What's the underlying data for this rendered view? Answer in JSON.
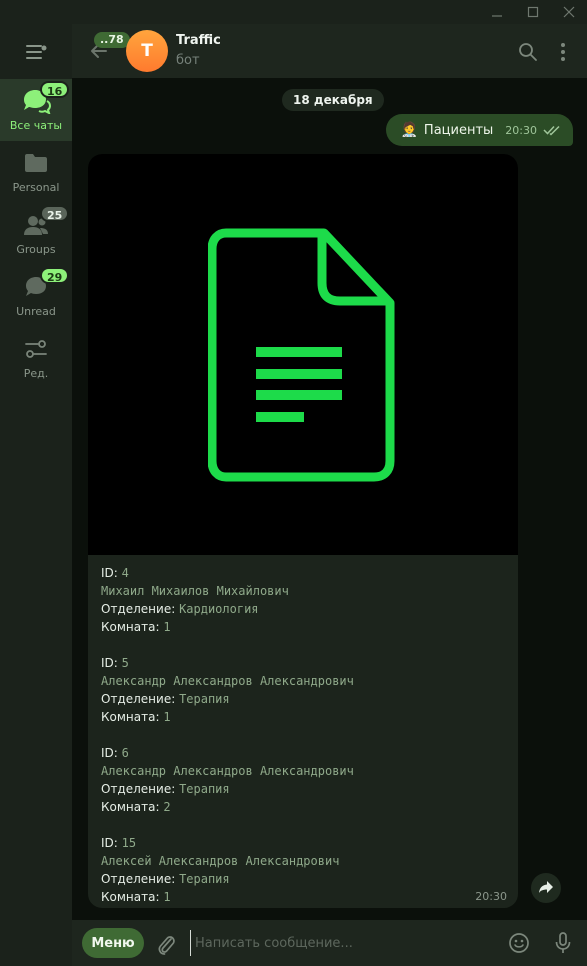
{
  "sidebar": {
    "items": [
      {
        "label": "Все чаты",
        "badge": "16",
        "badge_style": "green",
        "icon": "chats-icon"
      },
      {
        "label": "Personal",
        "badge": null,
        "icon": "folder-icon"
      },
      {
        "label": "Groups",
        "badge": "25",
        "badge_style": "gray",
        "icon": "groups-icon"
      },
      {
        "label": "Unread",
        "badge": "29",
        "badge_style": "green",
        "icon": "unread-chat-icon"
      },
      {
        "label": "Ред.",
        "badge": null,
        "icon": "edit-folders-icon"
      }
    ]
  },
  "header": {
    "unread_count": "..78",
    "avatar_letter": "T",
    "title": "Traffic",
    "subtitle": "бот"
  },
  "chat": {
    "date": "18 декабря",
    "outgoing": {
      "emoji": "🧑‍⚕️",
      "text": "Пациенты",
      "time": "20:30",
      "status": "read"
    },
    "incoming": {
      "time": "20:30",
      "labels": {
        "id": "ID: ",
        "department": "Отделение: ",
        "room": "Комната: "
      },
      "records": [
        {
          "id": "4",
          "name": "Михаил Михаилов Михайлович",
          "department": "Кардиология",
          "room": "1"
        },
        {
          "id": "5",
          "name": "Александр Александров Александрович",
          "department": "Терапия",
          "room": "1"
        },
        {
          "id": "6",
          "name": "Александр Александров Александрович",
          "department": "Терапия",
          "room": "2"
        },
        {
          "id": "15",
          "name": "Алексей Александров Александрович",
          "department": "Терапия",
          "room": "1"
        }
      ]
    }
  },
  "composer": {
    "menu_label": "Меню",
    "placeholder": "Написать сообщение..."
  },
  "colors": {
    "accent": "#8df07a",
    "document_icon": "#1ddb4a",
    "outgoing_bubble": "#2b4c26",
    "incoming_bubble": "#1c241c",
    "background": "#0b100b"
  }
}
